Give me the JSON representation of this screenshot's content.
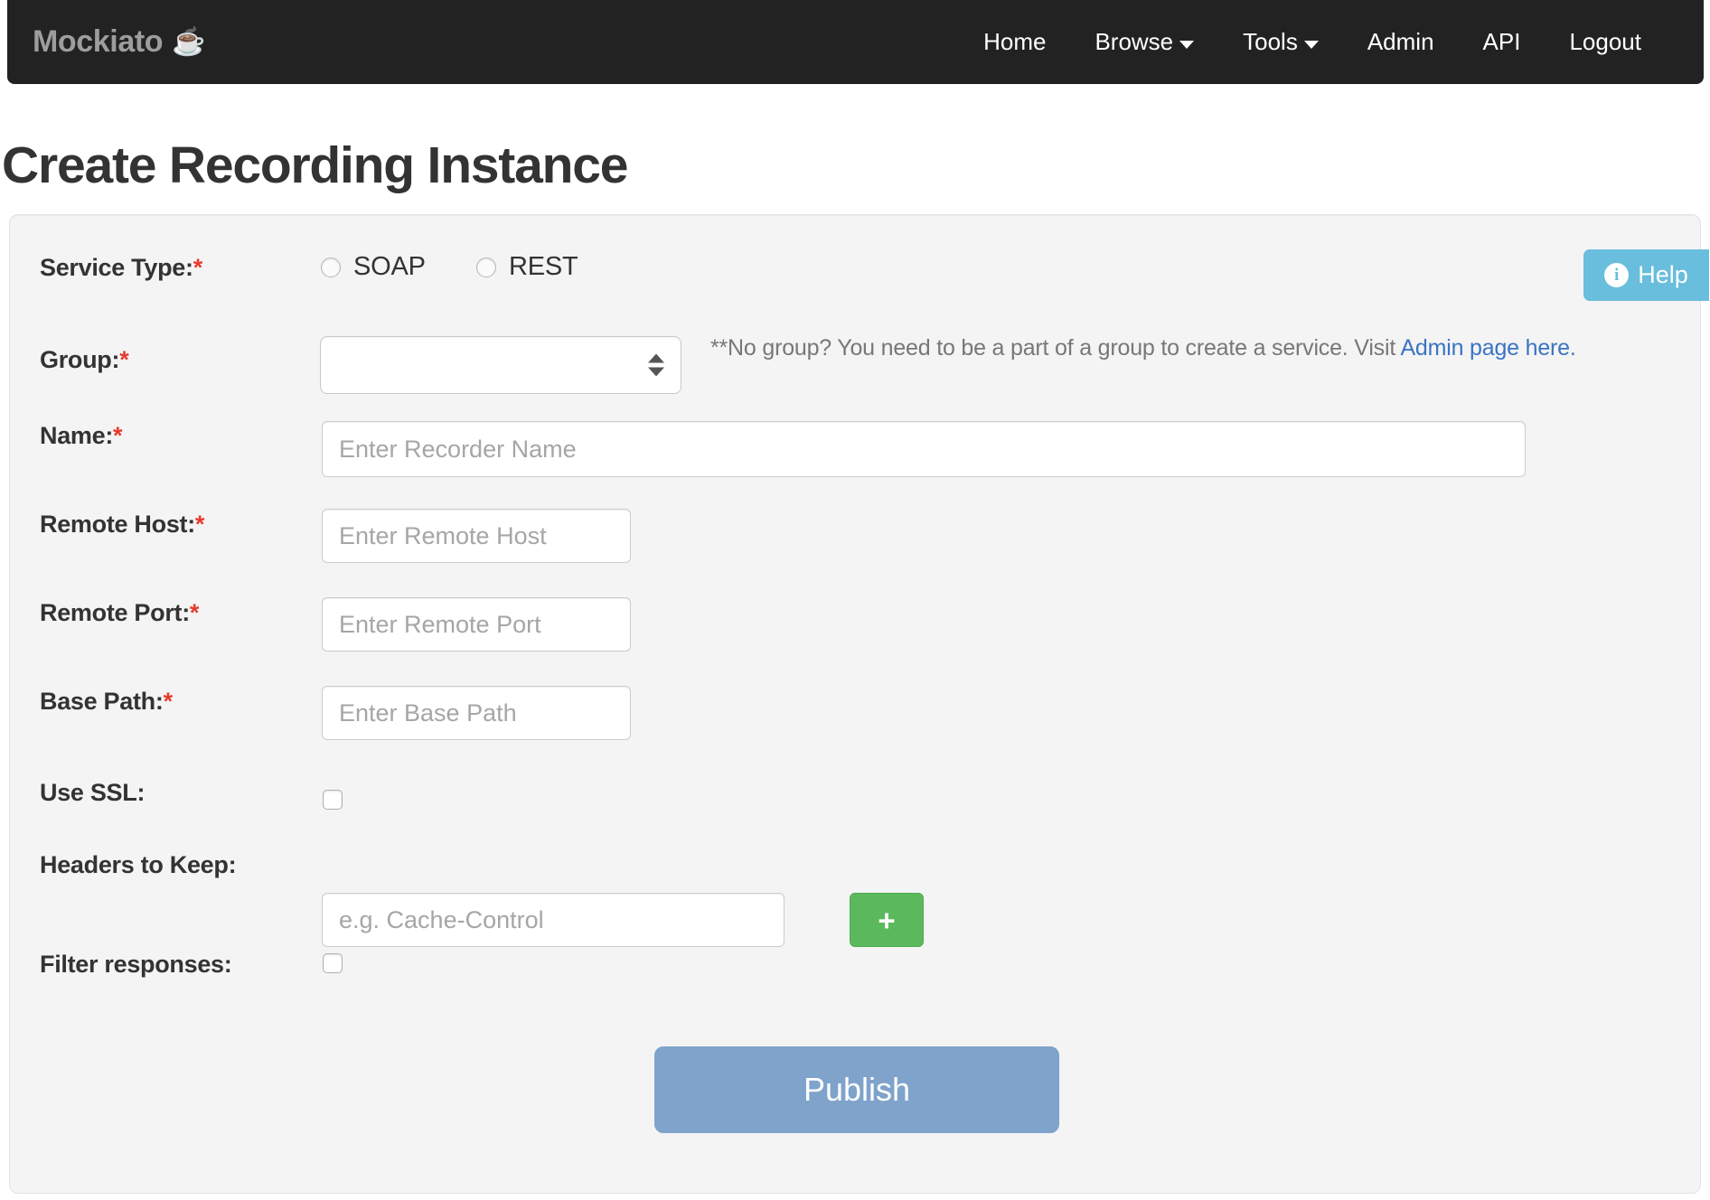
{
  "navbar": {
    "brand": "Mockiato",
    "brand_emoji": "☕",
    "links": [
      {
        "label": "Home",
        "caret": false
      },
      {
        "label": "Browse",
        "caret": true
      },
      {
        "label": "Tools",
        "caret": true
      },
      {
        "label": "Admin",
        "caret": false
      },
      {
        "label": "API",
        "caret": false
      },
      {
        "label": "Logout",
        "caret": false
      }
    ]
  },
  "page": {
    "title": "Create Recording Instance"
  },
  "help": {
    "label": "Help",
    "icon_glyph": "i",
    "color": "#69bddd"
  },
  "form": {
    "service_type": {
      "label": "Service Type:",
      "required": "*",
      "options": [
        {
          "label": "SOAP",
          "selected": false
        },
        {
          "label": "REST",
          "selected": false
        }
      ]
    },
    "group": {
      "label": "Group:",
      "required": "*",
      "value": "",
      "hint_prefix": "**No group? You need to be a part of a group to create a service. Visit ",
      "hint_link": "Admin page here."
    },
    "name": {
      "label": "Name:",
      "required": "*",
      "value": "",
      "placeholder": "Enter Recorder Name"
    },
    "remote_host": {
      "label": "Remote Host:",
      "required": "*",
      "value": "",
      "placeholder": "Enter Remote Host"
    },
    "remote_port": {
      "label": "Remote Port:",
      "required": "*",
      "value": "",
      "placeholder": "Enter Remote Port"
    },
    "base_path": {
      "label": "Base Path:",
      "required": "*",
      "value": "",
      "placeholder": "Enter Base Path"
    },
    "use_ssl": {
      "label": "Use SSL:",
      "checked": false
    },
    "headers_to_keep": {
      "label": "Headers to Keep:",
      "value": "",
      "placeholder": "e.g. Cache-Control",
      "add_label": "+",
      "add_color": "#5cb85c"
    },
    "filter_responses": {
      "label": "Filter responses:",
      "checked": false
    },
    "submit": {
      "label": "Publish",
      "color": "#7fa3ca"
    }
  }
}
